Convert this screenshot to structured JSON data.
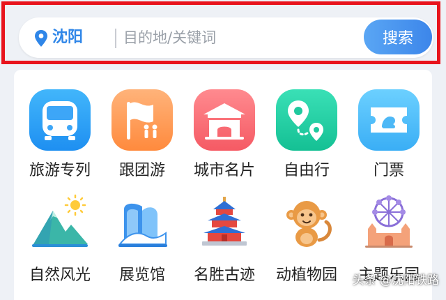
{
  "search": {
    "city": "沈阳",
    "placeholder": "目的地/关键词",
    "button_label": "搜索"
  },
  "categories": [
    {
      "label": "旅游专列",
      "icon": "train-icon"
    },
    {
      "label": "跟团游",
      "icon": "flag-group-icon"
    },
    {
      "label": "城市名片",
      "icon": "city-gate-icon"
    },
    {
      "label": "自由行",
      "icon": "route-pin-icon"
    },
    {
      "label": "门票",
      "icon": "ticket-icon"
    },
    {
      "label": "自然风光",
      "icon": "mountain-sun-icon"
    },
    {
      "label": "展览馆",
      "icon": "exhibition-building-icon"
    },
    {
      "label": "名胜古迹",
      "icon": "temple-icon"
    },
    {
      "label": "动植物园",
      "icon": "monkey-icon"
    },
    {
      "label": "主题乐园",
      "icon": "ferris-castle-icon"
    }
  ],
  "watermark": "头条 @沈阳铁路",
  "colors": {
    "accent": "#2f86e8",
    "highlight_border": "#e8141c",
    "search_button": "#4a95ee"
  }
}
